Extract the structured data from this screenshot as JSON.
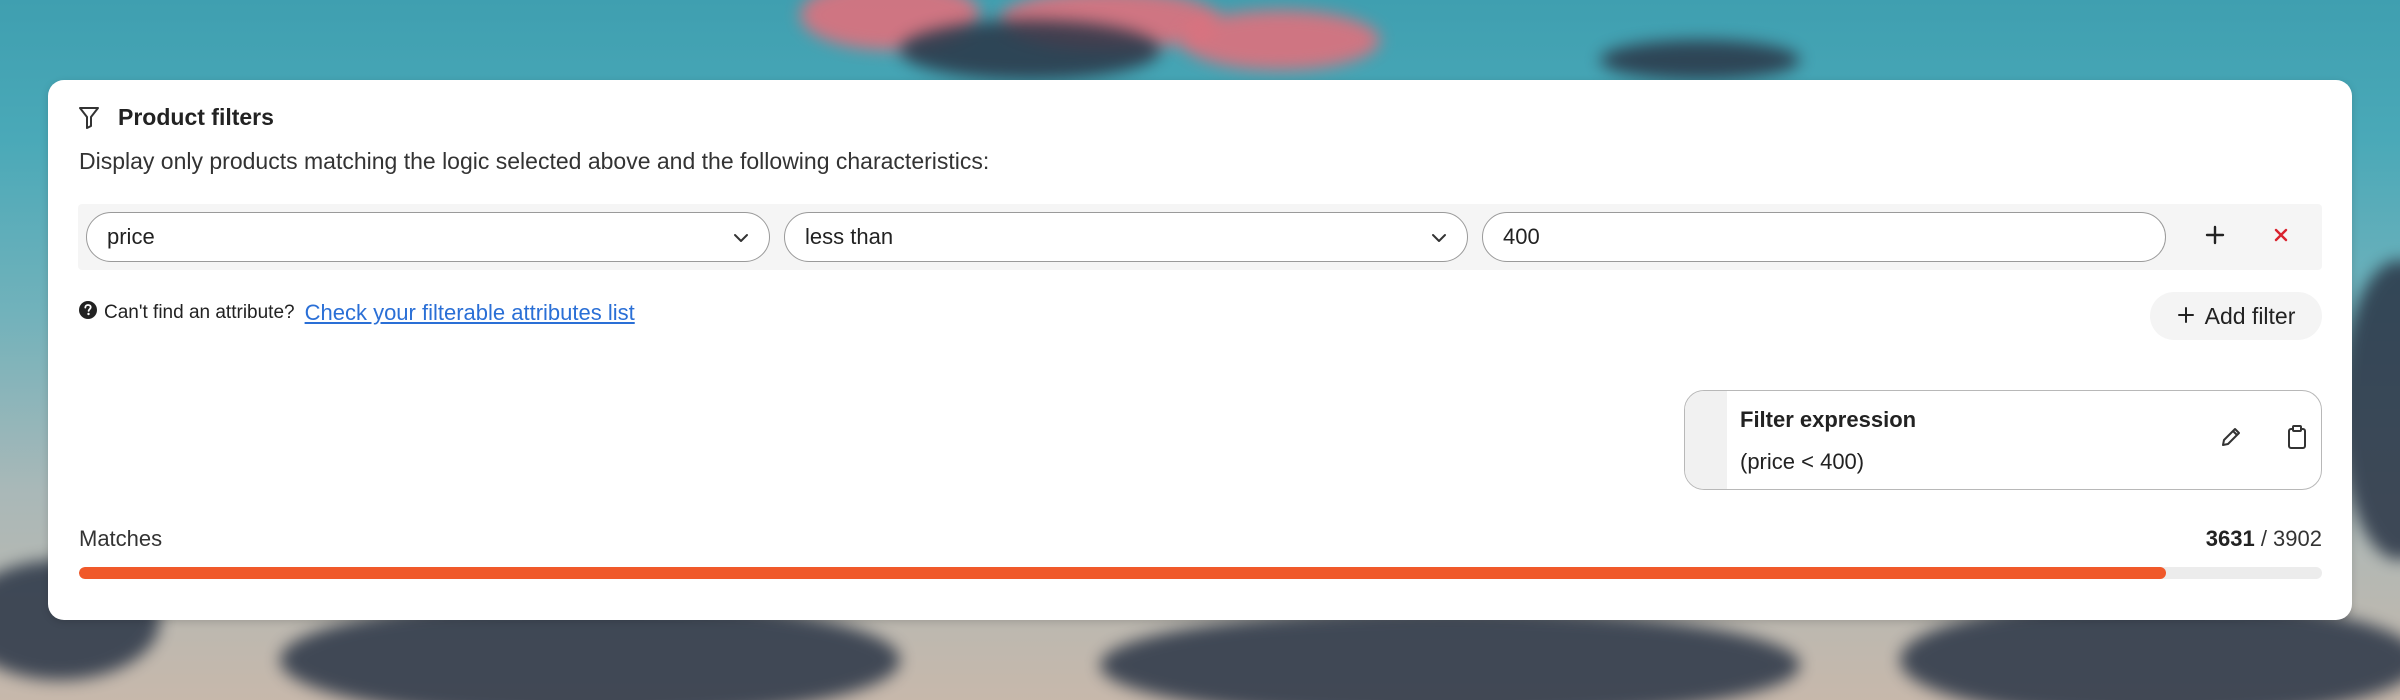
{
  "colors": {
    "accent": "#f0592a",
    "link": "#2a6fd6",
    "remove": "#d9232e"
  },
  "panel": {
    "icon": "filter-icon",
    "title": "Product filters",
    "description": "Display only products matching the logic selected above and the following characteristics:"
  },
  "filter_rows": [
    {
      "attribute": "price",
      "operator": "less than",
      "value": "400",
      "add_icon": "plus-icon",
      "remove_icon": "close-icon"
    }
  ],
  "help": {
    "icon": "question-circle-icon",
    "text": "Can't find an attribute?",
    "link_text": "Check your filterable attributes list"
  },
  "add_filter": {
    "icon": "plus-icon",
    "label": "Add filter"
  },
  "expression": {
    "title": "Filter expression",
    "value": "(price < 400)",
    "edit_icon": "pencil-icon",
    "copy_icon": "clipboard-icon"
  },
  "matches": {
    "label": "Matches",
    "matched": 3631,
    "separator": " / ",
    "total": 3902,
    "progress_fraction": 0.9305
  }
}
